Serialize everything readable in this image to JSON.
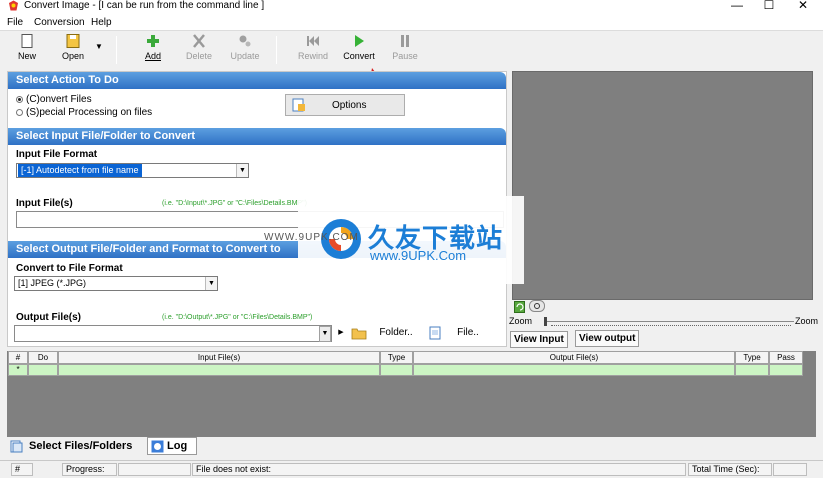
{
  "window": {
    "title": "Convert Image - [I can be run from the command line ]",
    "minimize": "—",
    "maximize": "☐",
    "close": "✕"
  },
  "menu": [
    "File",
    "Conversion",
    "Help"
  ],
  "toolbar": {
    "new": "New",
    "open": "Open",
    "add": "Add",
    "delete": "Delete",
    "update": "Update",
    "rewind": "Rewind",
    "convert": "Convert",
    "pause": "Pause"
  },
  "action_section": {
    "title": "Select Action To Do",
    "radio_convert": "(C)onvert Files",
    "radio_special": "(S)pecial Processing on files",
    "options_label": "Options"
  },
  "input_section": {
    "title": "Select Input File/Folder to Convert",
    "format_label": "Input File Format",
    "format_value": "[-1] Autodetect from file name",
    "files_label": "Input File(s)",
    "files_hint": "(i.e. \"D:\\Input\\*.JPG\" or \"C:\\Files\\Details.BMP\")",
    "files_value": ""
  },
  "output_section": {
    "title": "Select Output File/Folder and Format to Convert to",
    "format_label": "Convert to File Format",
    "format_value": "[1] JPEG (*.JPG)",
    "files_label": "Output File(s)",
    "files_hint": "(i.e. \"D:\\Output\\*.JPG\" or \"C:\\Files\\Details.BMP\")",
    "files_value": "",
    "folder_btn": "Folder..",
    "file_btn": "File.."
  },
  "preview": {
    "zoom_label": "Zoom",
    "zoom_right_label": "Zoom",
    "view_input": "View Input",
    "view_output": "View output"
  },
  "grid": {
    "columns": [
      "#",
      "Do",
      "Input File(s)",
      "Type",
      "Output File(s)",
      "Type",
      "Pass"
    ],
    "rows": [
      [
        "*",
        "",
        "",
        "",
        "",
        "",
        ""
      ]
    ]
  },
  "bottom_tabs": {
    "files": "Select Files/Folders",
    "log": "Log"
  },
  "status": {
    "num": "#",
    "progress": "Progress:",
    "message": "File does not exist:",
    "total_time": "Total Time (Sec):"
  },
  "watermark": {
    "brand_cn": "久友下载站",
    "url_small": "WWW.9UPK.COM",
    "url": "www.9UPK.Com"
  },
  "colors": {
    "section_header": "#2f71c5",
    "preview_bg": "#7f7f7f",
    "grid_bg": "#808080",
    "grid_row": "#ccf5c4",
    "selection": "#0a64d4",
    "hint": "#2a9e2a"
  }
}
